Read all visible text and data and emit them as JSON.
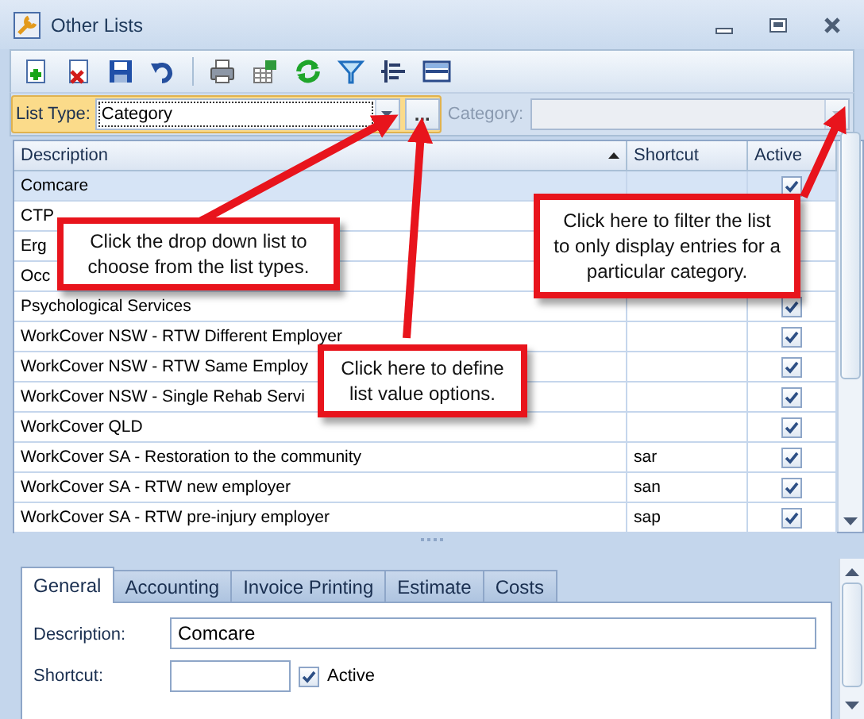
{
  "window": {
    "title": "Other Lists"
  },
  "filter": {
    "list_type_label": "List Type:",
    "list_type_value": "Category",
    "more_button": "...",
    "category_label": "Category:",
    "category_disabled": true
  },
  "grid": {
    "columns": [
      {
        "label": "Description",
        "sorted": true
      },
      {
        "label": "Shortcut",
        "sorted": false
      },
      {
        "label": "Active",
        "sorted": false
      }
    ],
    "rows": [
      {
        "description": "Comcare",
        "shortcut": "",
        "active": true,
        "selected": true
      },
      {
        "description": "CTP",
        "selected": false
      },
      {
        "description": "Erg",
        "selected": false
      },
      {
        "description": "Occ",
        "selected": false
      },
      {
        "description": "Psychological Services",
        "active": true,
        "selected": false
      },
      {
        "description": "WorkCover NSW - RTW Different Employer",
        "active": true,
        "selected": false
      },
      {
        "description": "WorkCover NSW - RTW Same Employ",
        "active": true,
        "selected": false
      },
      {
        "description": "WorkCover NSW - Single Rehab Servi",
        "active": true,
        "selected": false
      },
      {
        "description": "WorkCover QLD",
        "active": true,
        "selected": false
      },
      {
        "description": "WorkCover SA - Restoration to the community",
        "shortcut": "sar",
        "active": true,
        "selected": false
      },
      {
        "description": "WorkCover SA - RTW new employer",
        "shortcut": "san",
        "active": true,
        "selected": false
      },
      {
        "description": "WorkCover SA - RTW pre-injury employer",
        "shortcut": "sap",
        "active": true,
        "selected": false
      }
    ]
  },
  "detail": {
    "tabs": [
      {
        "label": "General",
        "selected": true
      },
      {
        "label": "Accounting",
        "selected": false
      },
      {
        "label": "Invoice Printing",
        "selected": false
      },
      {
        "label": "Estimate",
        "selected": false
      },
      {
        "label": "Costs",
        "selected": false
      }
    ],
    "description_label": "Description:",
    "description_value": "Comcare",
    "shortcut_label": "Shortcut:",
    "active_label": "Active",
    "active_checked": true
  },
  "callouts": [
    {
      "text": "Click the drop down list to choose from the list types."
    },
    {
      "text": "Click here to define list value options."
    },
    {
      "text": "Click here to filter the list to only display entries for a particular category."
    }
  ]
}
